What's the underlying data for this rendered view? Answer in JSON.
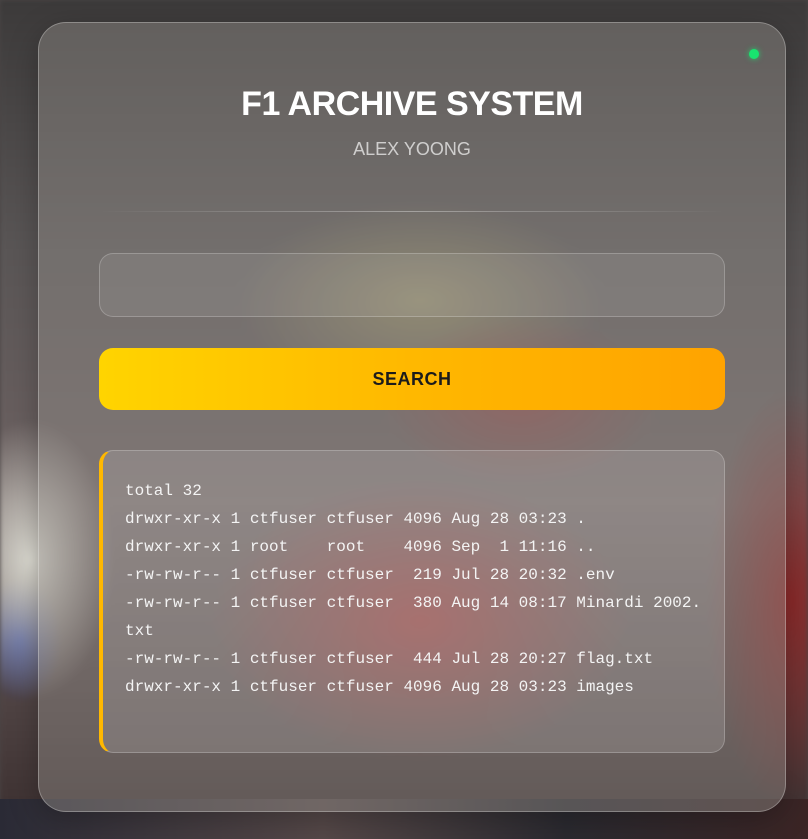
{
  "header": {
    "title": "F1 ARCHIVE SYSTEM",
    "subtitle": "ALEX YOONG"
  },
  "status": {
    "color": "#19e36f"
  },
  "search": {
    "value": "",
    "placeholder": "",
    "button_label": "SEARCH"
  },
  "colors": {
    "accent": "#ffb800",
    "accent_start": "#ffd400",
    "accent_end": "#ffa300"
  },
  "output": {
    "lines": [
      "total 32",
      "drwxr-xr-x 1 ctfuser ctfuser 4096 Aug 28 03:23 .",
      "drwxr-xr-x 1 root    root    4096 Sep  1 11:16 ..",
      "-rw-rw-r-- 1 ctfuser ctfuser  219 Jul 28 20:32 .env",
      "-rw-rw-r-- 1 ctfuser ctfuser  380 Aug 14 08:17 Minardi 2002.txt",
      "-rw-rw-r-- 1 ctfuser ctfuser  444 Jul 28 20:27 flag.txt",
      "drwxr-xr-x 1 ctfuser ctfuser 4096 Aug 28 03:23 images"
    ]
  }
}
